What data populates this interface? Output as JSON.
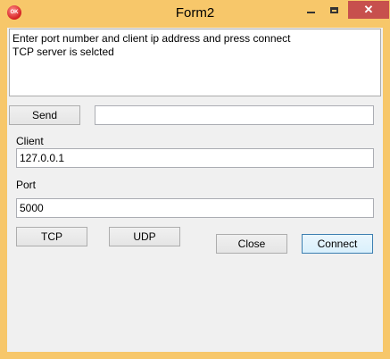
{
  "window": {
    "title": "Form2",
    "icon_text": "OK",
    "controls": {
      "close_glyph": "✕"
    }
  },
  "log": {
    "lines": [
      "Enter port number and client ip address and press connect",
      "TCP server is selcted"
    ]
  },
  "send": {
    "button_label": "Send",
    "message_value": ""
  },
  "client": {
    "label": "Client",
    "value": "127.0.0.1"
  },
  "port": {
    "label": "Port",
    "value": "5000"
  },
  "buttons": {
    "tcp": "TCP",
    "udp": "UDP",
    "close": "Close",
    "connect": "Connect"
  },
  "colors": {
    "title_bar": "#f7c76a",
    "close_button": "#c7504d",
    "default_button_border": "#3c7fb1"
  }
}
